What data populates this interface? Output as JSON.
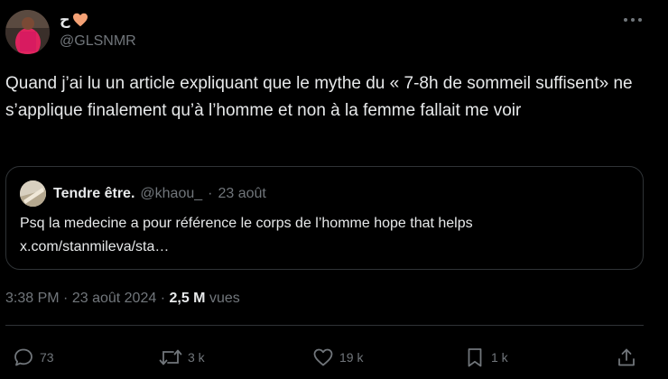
{
  "author": {
    "name": "ح",
    "emoji": "🧡",
    "handle": "@GLSNMR"
  },
  "tweet": {
    "text": "Quand j’ai lu un article expliquant que le mythe du « 7-8h de sommeil suffisent» ne s’applique finalement qu’à l’homme et non à la femme fallait me voir"
  },
  "quoted_tweet": {
    "name": "Tendre être.",
    "handle": "@khaou_",
    "separator": "·",
    "date": "23 août",
    "text_line1": "Psq la medecine a pour référence le corps de l’homme hope that helps",
    "text_line2": "x.com/stanmileva/sta…"
  },
  "meta": {
    "time": "3:38 PM",
    "separator": "·",
    "date": "23 août 2024",
    "views_count": "2,5 M",
    "views_label": "vues"
  },
  "actions": {
    "replies": "73",
    "retweets": "3 k",
    "likes": "19 k",
    "bookmarks": "1 k"
  },
  "icons": {
    "more": "more-icon",
    "reply": "reply-icon",
    "retweet": "retweet-icon",
    "like": "heart-icon",
    "bookmark": "bookmark-icon",
    "share": "share-icon"
  },
  "colors": {
    "background": "#000000",
    "text": "#e7e9ea",
    "muted": "#71767b",
    "border": "#2f3336"
  }
}
